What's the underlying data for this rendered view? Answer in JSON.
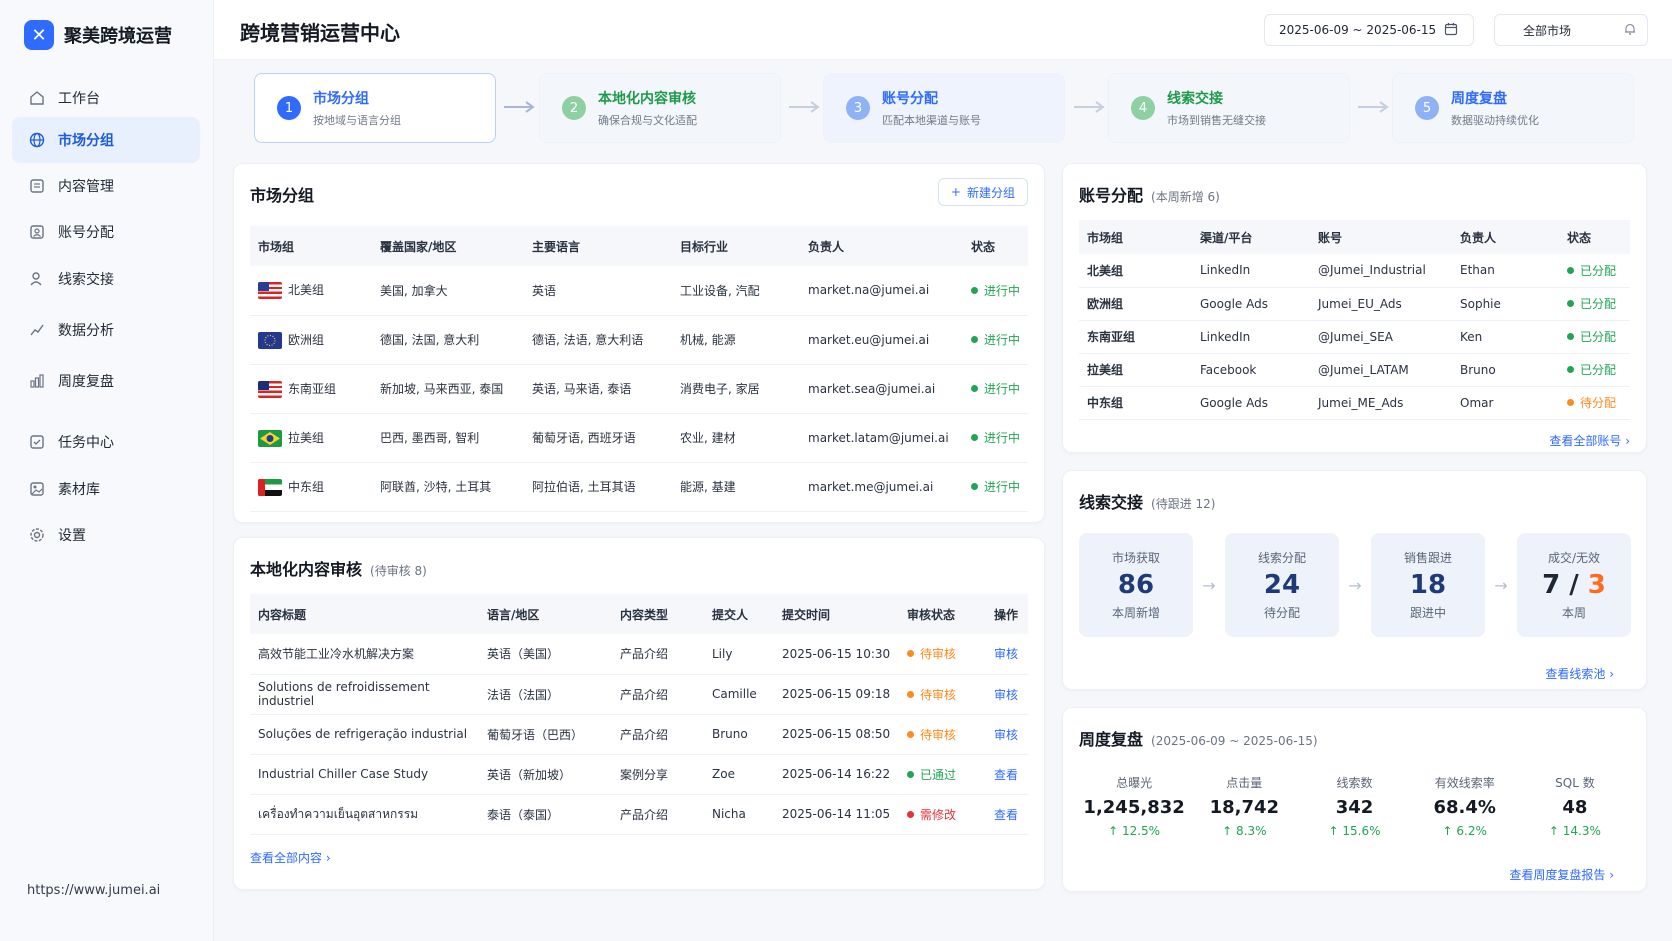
{
  "brand": {
    "name": "聚美跨境运营"
  },
  "nav": {
    "items": [
      {
        "label": "工作台",
        "icon": "home-icon"
      },
      {
        "label": "市场分组",
        "icon": "globe-icon",
        "active": true
      },
      {
        "label": "内容管理",
        "icon": "content-icon"
      },
      {
        "label": "账号分配",
        "icon": "accounts-icon"
      },
      {
        "label": "线索交接",
        "icon": "handoff-icon"
      },
      {
        "label": "数据分析",
        "icon": "analytics-icon"
      },
      {
        "label": "周度复盘",
        "icon": "review-icon"
      },
      {
        "label": "任务中心",
        "icon": "task-icon"
      },
      {
        "label": "素材库",
        "icon": "asset-icon"
      },
      {
        "label": "设置",
        "icon": "gear-icon"
      }
    ]
  },
  "footer": {
    "url": "https://www.jumei.ai"
  },
  "header": {
    "title": "跨境营销运营中心",
    "date_range": "2025-06-09 ~ 2025-06-15",
    "market": "全部市场"
  },
  "steps": [
    {
      "num": "1",
      "title": "市场分组",
      "sub": "按地域与语言分组",
      "color": "#2f6bff"
    },
    {
      "num": "2",
      "title": "本地化内容审核",
      "sub": "确保合规与文化适配",
      "color": "#22a454"
    },
    {
      "num": "3",
      "title": "账号分配",
      "sub": "匹配本地渠道与账号",
      "color": "#2f6bff"
    },
    {
      "num": "4",
      "title": "线索交接",
      "sub": "市场到销售无缝交接",
      "color": "#22a454"
    },
    {
      "num": "5",
      "title": "周度复盘",
      "sub": "数据驱动持续优化",
      "color": "#2f6bff"
    }
  ],
  "market_groups": {
    "title": "市场分组",
    "new_button": "新建分组",
    "columns": [
      "市场组",
      "覆盖国家/地区",
      "主要语言",
      "目标行业",
      "负责人",
      "状态"
    ],
    "rows": [
      {
        "flag": "us",
        "name": "北美组",
        "countries": "美国, 加拿大",
        "languages": "英语",
        "industry": "工业设备, 汽配",
        "owner": "market.na@jumei.ai",
        "status": "进行中"
      },
      {
        "flag": "eu",
        "name": "欧洲组",
        "countries": "德国, 法国, 意大利",
        "languages": "德语, 法语, 意大利语",
        "industry": "机械, 能源",
        "owner": "market.eu@jumei.ai",
        "status": "进行中"
      },
      {
        "flag": "my",
        "name": "东南亚组",
        "countries": "新加坡, 马来西亚, 泰国",
        "languages": "英语, 马来语, 泰语",
        "industry": "消费电子, 家居",
        "owner": "market.sea@jumei.ai",
        "status": "进行中"
      },
      {
        "flag": "br",
        "name": "拉美组",
        "countries": "巴西, 墨西哥, 智利",
        "languages": "葡萄牙语, 西班牙语",
        "industry": "农业, 建材",
        "owner": "market.latam@jumei.ai",
        "status": "进行中"
      },
      {
        "flag": "ae",
        "name": "中东组",
        "countries": "阿联酋, 沙特, 土耳其",
        "languages": "阿拉伯语, 土耳其语",
        "industry": "能源, 基建",
        "owner": "market.me@jumei.ai",
        "status": "进行中"
      }
    ]
  },
  "content_review": {
    "title": "本地化内容审核",
    "sub": "(待审核 8)",
    "columns": [
      "内容标题",
      "语言/地区",
      "内容类型",
      "提交人",
      "提交时间",
      "审核状态",
      "操作"
    ],
    "rows": [
      {
        "title": "高效节能工业冷水机解决方案",
        "lang": "英语（美国）",
        "type": "产品介绍",
        "by": "Lily",
        "time": "2025-06-15 10:30",
        "status": "待审核",
        "status_color": "#ff8a1f",
        "action": "审核"
      },
      {
        "title": "Solutions de refroidissement industriel",
        "lang": "法语（法国）",
        "type": "产品介绍",
        "by": "Camille",
        "time": "2025-06-15 09:18",
        "status": "待审核",
        "status_color": "#ff8a1f",
        "action": "审核"
      },
      {
        "title": "Soluções de refrigeração industrial",
        "lang": "葡萄牙语（巴西）",
        "type": "产品介绍",
        "by": "Bruno",
        "time": "2025-06-15 08:50",
        "status": "待审核",
        "status_color": "#ff8a1f",
        "action": "审核"
      },
      {
        "title": "Industrial Chiller Case Study",
        "lang": "英语（新加坡）",
        "type": "案例分享",
        "by": "Zoe",
        "time": "2025-06-14 16:22",
        "status": "已通过",
        "status_color": "#22a454",
        "action": "查看"
      },
      {
        "title": "เครื่องทำความเย็นอุตสาหกรรม",
        "lang": "泰语（泰国）",
        "type": "产品介绍",
        "by": "Nicha",
        "time": "2025-06-14 11:05",
        "status": "需修改",
        "status_color": "#e5323a",
        "action": "查看"
      }
    ],
    "more": "查看全部内容 ›"
  },
  "account_assignment": {
    "title": "账号分配",
    "sub": "(本周新增 6)",
    "columns": [
      "市场组",
      "渠道/平台",
      "账号",
      "负责人",
      "状态"
    ],
    "rows": [
      {
        "group": "北美组",
        "channel": "LinkedIn",
        "account": "@Jumei_Industrial",
        "owner": "Ethan",
        "status": "已分配",
        "status_color": "#22a454"
      },
      {
        "group": "欧洲组",
        "channel": "Google Ads",
        "account": "Jumei_EU_Ads",
        "owner": "Sophie",
        "status": "已分配",
        "status_color": "#22a454"
      },
      {
        "group": "东南亚组",
        "channel": "LinkedIn",
        "account": "@Jumei_SEA",
        "owner": "Ken",
        "status": "已分配",
        "status_color": "#22a454"
      },
      {
        "group": "拉美组",
        "channel": "Facebook",
        "account": "@Jumei_LATAM",
        "owner": "Bruno",
        "status": "已分配",
        "status_color": "#22a454"
      },
      {
        "group": "中东组",
        "channel": "Google Ads",
        "account": "Jumei_ME_Ads",
        "owner": "Omar",
        "status": "待分配",
        "status_color": "#ff8a1f"
      }
    ],
    "more": "查看全部账号 ›"
  },
  "lead_handoff": {
    "title": "线索交接",
    "sub": "(待跟进 12)",
    "stages": [
      {
        "label": "市场获取",
        "value": "86",
        "sub": "本周新增"
      },
      {
        "label": "线索分配",
        "value": "24",
        "sub": "待分配"
      },
      {
        "label": "销售跟进",
        "value": "18",
        "sub": "跟进中"
      },
      {
        "label": "成交/无效",
        "value_main": "7",
        "value_sep": " / ",
        "value_alt": "3",
        "sub": "本周"
      }
    ],
    "more": "查看线索池 ›"
  },
  "weekly_review": {
    "title": "周度复盘",
    "sub": "(2025-06-09 ~ 2025-06-15)",
    "metrics": [
      {
        "label": "总曝光",
        "value": "1,245,832",
        "change": "↑ 12.5%"
      },
      {
        "label": "点击量",
        "value": "18,742",
        "change": "↑ 8.3%"
      },
      {
        "label": "线索数",
        "value": "342",
        "change": "↑ 15.6%"
      },
      {
        "label": "有效线索率",
        "value": "68.4%",
        "change": "↑ 6.2%"
      },
      {
        "label": "SQL 数",
        "value": "48",
        "change": "↑ 14.3%"
      }
    ],
    "more": "查看周度复盘报告 ›"
  }
}
